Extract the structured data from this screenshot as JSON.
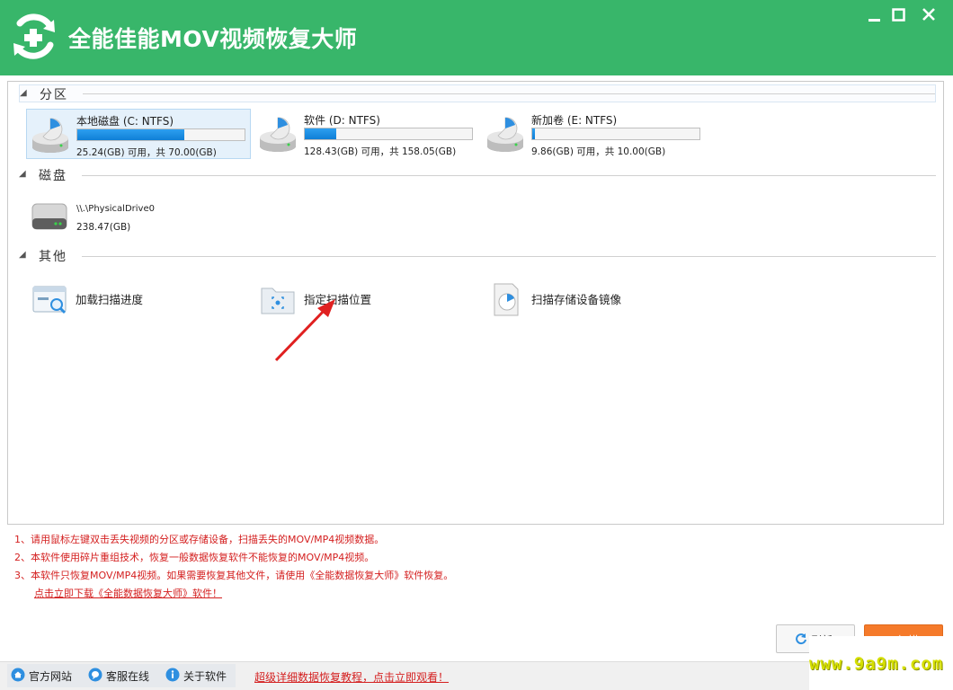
{
  "window": {
    "title": "全能佳能MOV视频恢复大师",
    "minimize_icon": "minimize-icon",
    "maximize_icon": "maximize-icon",
    "close_icon": "close-icon",
    "accent_color": "#38b66a"
  },
  "sections": {
    "partitions": {
      "label": "分区",
      "drives": [
        {
          "name": "本地磁盘 (C: NTFS)",
          "size": "25.24(GB) 可用，共 70.00(GB)",
          "used_fraction": 0.64,
          "selected": true
        },
        {
          "name": "软件 (D: NTFS)",
          "size": "128.43(GB) 可用，共 158.05(GB)",
          "used_fraction": 0.19,
          "selected": false
        },
        {
          "name": "新加卷 (E: NTFS)",
          "size": "9.86(GB) 可用，共 10.00(GB)",
          "used_fraction": 0.01,
          "selected": false
        }
      ]
    },
    "disks": {
      "label": "磁盘",
      "items": [
        {
          "name": "\\\\.\\PhysicalDrive0",
          "size": "238.47(GB)"
        }
      ]
    },
    "others": {
      "label": "其他",
      "items": [
        {
          "label": "加载扫描进度",
          "icon": "load-scan-progress-icon"
        },
        {
          "label": "指定扫描位置",
          "icon": "folder-scan-icon"
        },
        {
          "label": "扫描存储设备镜像",
          "icon": "disk-image-icon"
        }
      ]
    }
  },
  "notes": {
    "lines": [
      "1、请用鼠标左键双击丢失视频的分区或存储设备，扫描丢失的MOV/MP4视频数据。",
      "2、本软件使用碎片重组技术，恢复一般数据恢复软件不能恢复的MOV/MP4视频。",
      "3、本软件只恢复MOV/MP4视频。如果需要恢复其他文件，请使用《全能数据恢复大师》软件恢复。"
    ],
    "download_link": "点击立即下载《全能数据恢复大师》软件！"
  },
  "buttons": {
    "refresh": "刷新",
    "scan": "扫描"
  },
  "footer": {
    "website": "官方网站",
    "support": "客服在线",
    "about": "关于软件",
    "tutorial": "超级详细数据恢复教程，点击立即观看！"
  },
  "watermark": "www.9a9m.com"
}
